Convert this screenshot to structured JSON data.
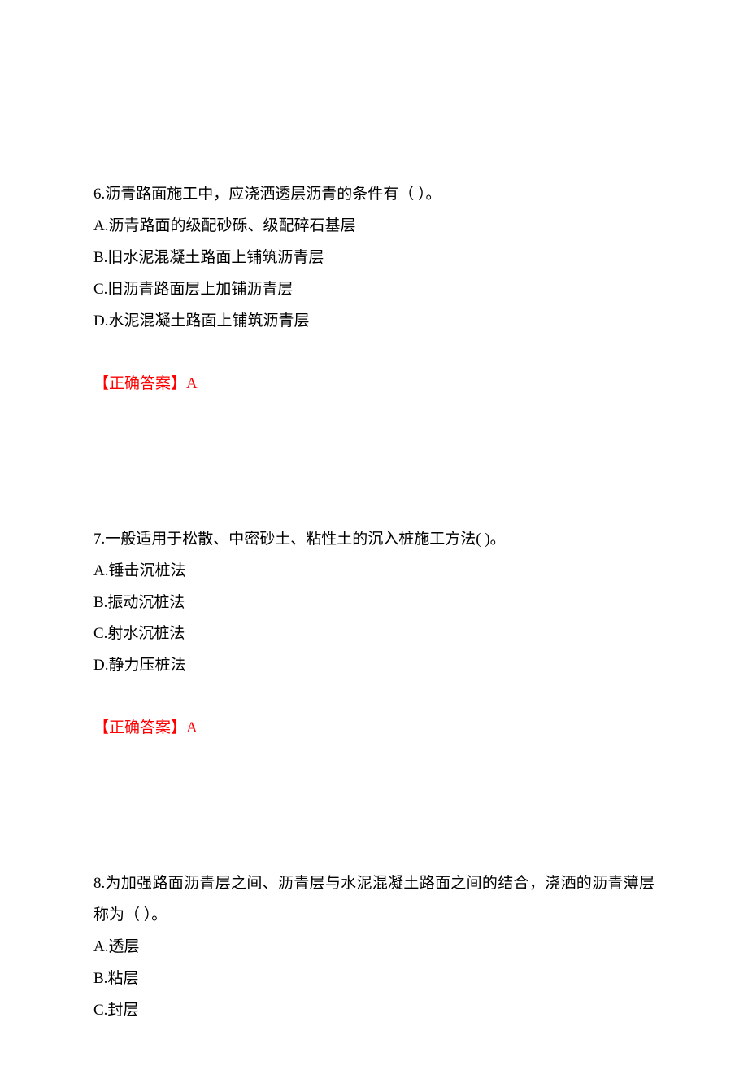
{
  "questions": [
    {
      "stem": "6.沥青路面施工中，应浇洒透层沥青的条件有（  ）。",
      "options": [
        "A.沥青路面的级配砂砾、级配碎石基层",
        "B.旧水泥混凝土路面上铺筑沥青层",
        "C.旧沥青路面层上加铺沥青层",
        "D.水泥混凝土路面上铺筑沥青层"
      ],
      "answer": "【正确答案】A"
    },
    {
      "stem": "7.一般适用于松散、中密砂土、粘性土的沉入桩施工方法(   )。",
      "options": [
        "A.锤击沉桩法",
        "B.振动沉桩法",
        "C.射水沉桩法",
        "D.静力压桩法"
      ],
      "answer": "【正确答案】A"
    },
    {
      "stem": "8.为加强路面沥青层之间、沥青层与水泥混凝土路面之间的结合，浇洒的沥青薄层称为（  ）。",
      "options": [
        "A.透层",
        "B.粘层",
        "C.封层"
      ],
      "answer": ""
    }
  ]
}
